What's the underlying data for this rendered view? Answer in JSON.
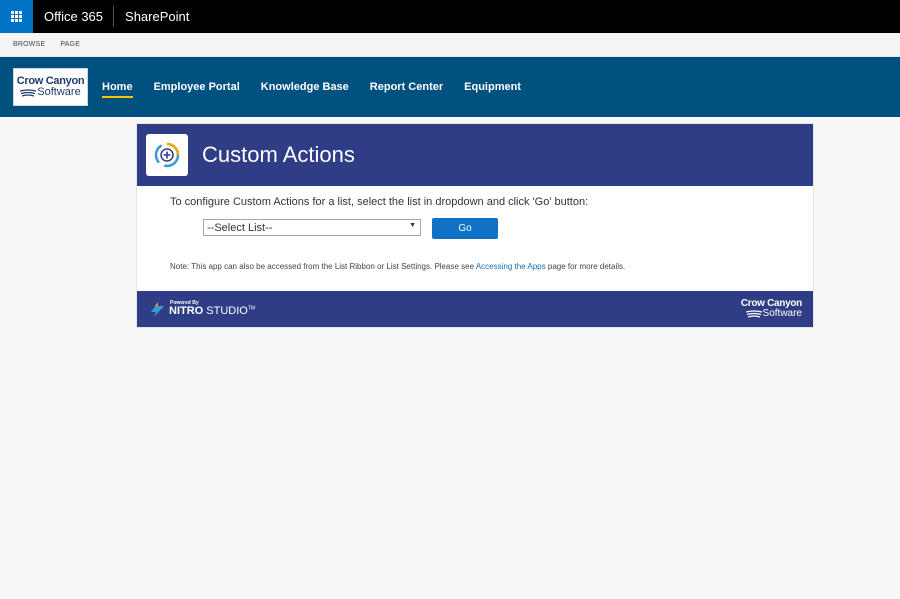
{
  "suitebar": {
    "suite_title": "Office 365",
    "app_title": "SharePoint",
    "app_launcher_icon": "waffle-icon"
  },
  "ribbon": {
    "tabs": [
      "BROWSE",
      "PAGE"
    ]
  },
  "site": {
    "logo_line1": "Crow Canyon",
    "logo_line2": "Software",
    "nav": [
      {
        "label": "Home",
        "active": true
      },
      {
        "label": "Employee Portal",
        "active": false
      },
      {
        "label": "Knowledge Base",
        "active": false
      },
      {
        "label": "Report Center",
        "active": false
      },
      {
        "label": "Equipment",
        "active": false
      }
    ],
    "header_color": "#005080",
    "active_underline_color": "#f7c600"
  },
  "panel": {
    "title": "Custom Actions",
    "icon": "custom-actions-icon",
    "instruction": "To configure Custom Actions for a list, select the list in dropdown and click 'Go' button:",
    "select_value": "--Select List--",
    "go_label": "Go",
    "note_prefix": "Note: This app can also be accessed from the List Ribbon or List Settings. Please see ",
    "note_link": "Accessing the Apps",
    "note_suffix": " page for more details.",
    "header_color": "#2f3c86",
    "button_color": "#0f72c4"
  },
  "footer": {
    "powered_by": "Powered By",
    "nitro_bold": "NITRO",
    "nitro_rest": " STUDIO",
    "tm": "TM",
    "brand_line1": "Crow Canyon",
    "brand_line2": "Software"
  }
}
